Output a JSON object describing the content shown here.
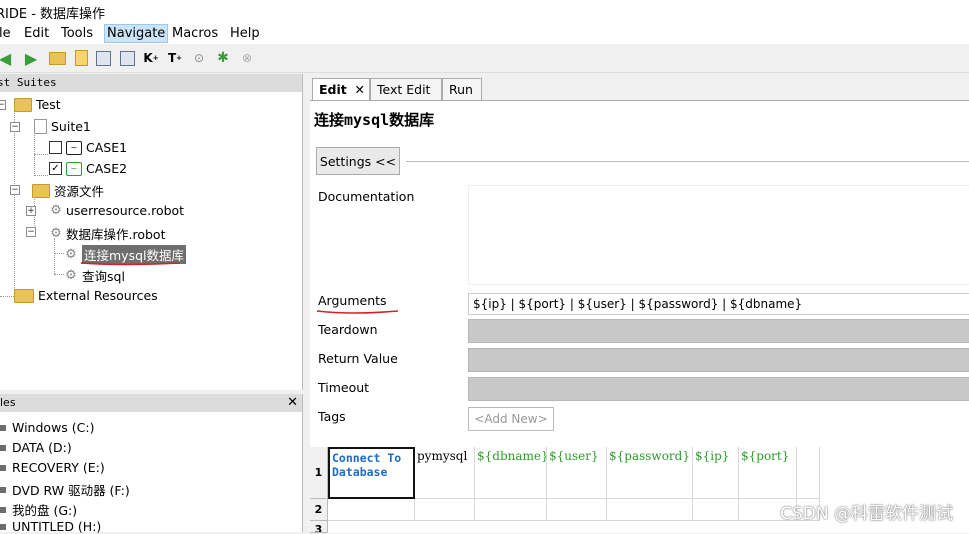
{
  "window": {
    "title": "RIDE - 数据库操作"
  },
  "menu": [
    "le",
    "Edit",
    "Tools",
    "Navigate",
    "Macros",
    "Help"
  ],
  "tree": {
    "header": "st Suites",
    "nodes": {
      "test": "Test",
      "suite1": "Suite1",
      "case1": "CASE1",
      "case2": "CASE2",
      "resources": "资源文件",
      "user_resource": "userresource.robot",
      "db_resource": "数据库操作.robot",
      "kw_connect": "连接mysql数据库",
      "kw_query": "查询sql",
      "external": "External Resources"
    },
    "case1_checked": false,
    "case2_checked": true
  },
  "files": {
    "header": "les",
    "drives": [
      "Windows (C:)",
      "DATA (D:)",
      "RECOVERY (E:)",
      "DVD RW 驱动器 (F:)",
      "我的盘 (G:)",
      "UNTITLED (H:)"
    ]
  },
  "editor": {
    "tabs": [
      "Edit",
      "Text Edit",
      "Run"
    ],
    "keyword_title": "连接mysql数据库",
    "settings_label": "Settings <<",
    "fields": {
      "documentation": "Documentation",
      "arguments": "Arguments",
      "arguments_value": "${ip} | ${port} | ${user} | ${password} | ${dbname}",
      "teardown": "Teardown",
      "return_value": "Return Value",
      "timeout": "Timeout",
      "tags": "Tags",
      "add_new": "<Add New>"
    },
    "grid": {
      "row_numbers": [
        "1",
        "2",
        "3"
      ],
      "row1": [
        "Connect To Database",
        "pymysql",
        "${dbname}",
        "${user}",
        "${password}",
        "${ip}",
        "${port}"
      ]
    }
  },
  "watermark": "CSDN @科雷软件测试",
  "colors": {
    "keyword": "#1f6bc4",
    "argument": "#2a9d2a",
    "annotation_underline": "#d62020"
  }
}
